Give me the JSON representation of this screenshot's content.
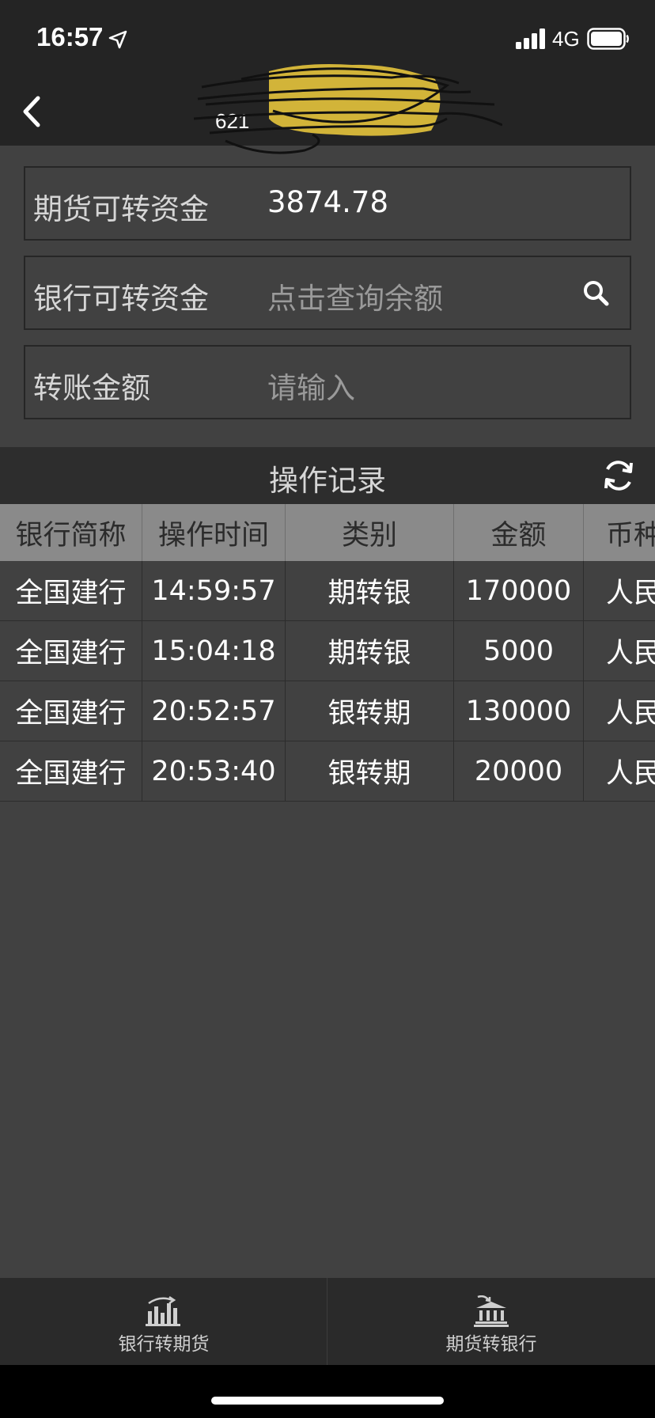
{
  "status_bar": {
    "time": "16:57",
    "network": "4G"
  },
  "nav": {
    "title_visible": "621"
  },
  "form": {
    "futures_label": "期货可转资金",
    "futures_value": "3874.78",
    "bank_label": "银行可转资金",
    "bank_placeholder": "点击查询余额",
    "amount_label": "转账金额",
    "amount_placeholder": "请输入"
  },
  "records": {
    "title": "操作记录",
    "columns": [
      "银行简称",
      "操作时间",
      "类别",
      "金额",
      "币种"
    ],
    "rows": [
      {
        "bank": "全国建行",
        "time": "14:59:57",
        "type": "期转银",
        "amount": "170000",
        "currency": "人民币"
      },
      {
        "bank": "全国建行",
        "time": "15:04:18",
        "type": "期转银",
        "amount": "5000",
        "currency": "人民币"
      },
      {
        "bank": "全国建行",
        "time": "20:52:57",
        "type": "银转期",
        "amount": "130000",
        "currency": "人民币"
      },
      {
        "bank": "全国建行",
        "time": "20:53:40",
        "type": "银转期",
        "amount": "20000",
        "currency": "人民币"
      }
    ]
  },
  "tabs": [
    {
      "label": "银行转期货",
      "icon": "bar-chart-icon"
    },
    {
      "label": "期货转银行",
      "icon": "bank-icon"
    }
  ]
}
